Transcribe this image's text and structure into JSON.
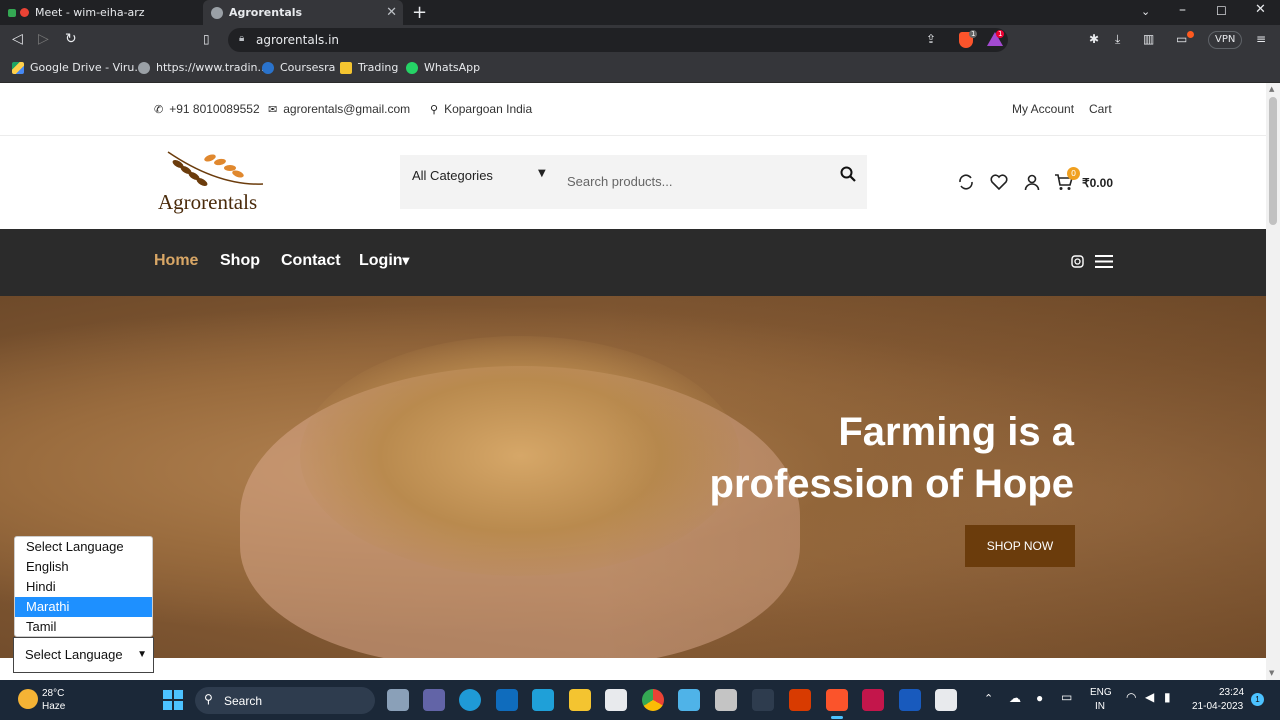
{
  "browser": {
    "tabs": [
      {
        "title": "Meet - wim-eiha-arz",
        "active": false
      },
      {
        "title": "Agrorentals",
        "active": true
      }
    ],
    "url": "agrorentals.in",
    "vpn_label": "VPN",
    "bookmarks": [
      {
        "label": "Google Drive - Viru..."
      },
      {
        "label": "https://www.tradin..."
      },
      {
        "label": "Coursesra"
      },
      {
        "label": "Trading"
      },
      {
        "label": "WhatsApp"
      }
    ],
    "ext_badge_1": "1",
    "ext_badge_2": "1"
  },
  "site": {
    "topbar": {
      "phone": "+91 8010089552",
      "email": "agrorentals@gmail.com",
      "location": "Kopargoan India",
      "my_account": "My Account",
      "cart": "Cart"
    },
    "header": {
      "logo_text": "Agrorentals",
      "category_select": "All Categories",
      "search_placeholder": "Search products...",
      "cart_count": "0",
      "cart_total": "₹0.00"
    },
    "nav": {
      "home": "Home",
      "shop": "Shop",
      "contact": "Contact",
      "login": "Login"
    },
    "hero": {
      "title_line1": "Farming is a",
      "title_line2": "profession of Hope",
      "cta": "SHOP NOW"
    },
    "language": {
      "options": [
        "Select Language",
        "English",
        "Hindi",
        "Marathi",
        "Tamil"
      ],
      "highlighted": "Marathi",
      "selected": "Select Language"
    }
  },
  "taskbar": {
    "weather_temp": "28°C",
    "weather_desc": "Haze",
    "search_label": "Search",
    "lang_top": "ENG",
    "lang_bottom": "IN",
    "time": "23:24",
    "date": "21-04-2023",
    "notification_count": "1"
  }
}
